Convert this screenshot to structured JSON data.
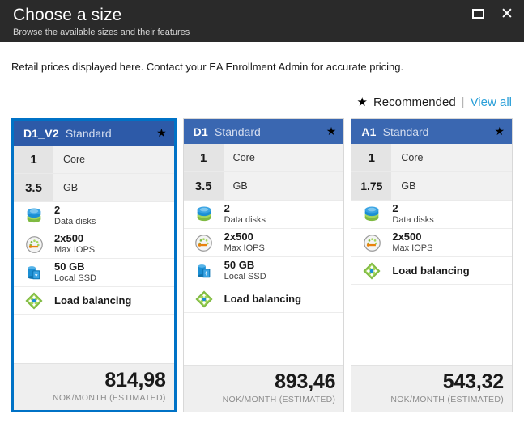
{
  "window": {
    "title": "Choose a size",
    "subtitle": "Browse the available sizes and their features",
    "maximize_icon": "maximize-icon",
    "close_icon": "close-icon"
  },
  "notice": "Retail prices displayed here. Contact your EA Enrollment Admin for accurate pricing.",
  "filters": {
    "star_glyph": "★",
    "recommended_label": "Recommended",
    "separator": "|",
    "view_all_label": "View all",
    "link_color": "#2a9fd8"
  },
  "cards": [
    {
      "name": "D1_V2",
      "tier": "Standard",
      "star_glyph": "★",
      "selected": true,
      "specs": [
        {
          "value": "1",
          "label": "Core"
        },
        {
          "value": "3.5",
          "label": "GB"
        }
      ],
      "features": [
        {
          "icon": "data-disks-icon",
          "value": "2",
          "caption": "Data disks"
        },
        {
          "icon": "max-iops-icon",
          "value": "2x500",
          "caption": "Max IOPS"
        },
        {
          "icon": "local-ssd-icon",
          "value": "50 GB",
          "caption": "Local SSD"
        },
        {
          "icon": "load-balancing-icon",
          "value": "Load balancing",
          "caption": ""
        }
      ],
      "price": "814,98",
      "price_unit": "NOK/MONTH (ESTIMATED)"
    },
    {
      "name": "D1",
      "tier": "Standard",
      "star_glyph": "★",
      "selected": false,
      "specs": [
        {
          "value": "1",
          "label": "Core"
        },
        {
          "value": "3.5",
          "label": "GB"
        }
      ],
      "features": [
        {
          "icon": "data-disks-icon",
          "value": "2",
          "caption": "Data disks"
        },
        {
          "icon": "max-iops-icon",
          "value": "2x500",
          "caption": "Max IOPS"
        },
        {
          "icon": "local-ssd-icon",
          "value": "50 GB",
          "caption": "Local SSD"
        },
        {
          "icon": "load-balancing-icon",
          "value": "Load balancing",
          "caption": ""
        }
      ],
      "price": "893,46",
      "price_unit": "NOK/MONTH (ESTIMATED)"
    },
    {
      "name": "A1",
      "tier": "Standard",
      "star_glyph": "★",
      "selected": false,
      "specs": [
        {
          "value": "1",
          "label": "Core"
        },
        {
          "value": "1.75",
          "label": "GB"
        }
      ],
      "features": [
        {
          "icon": "data-disks-icon",
          "value": "2",
          "caption": "Data disks"
        },
        {
          "icon": "max-iops-icon",
          "value": "2x500",
          "caption": "Max IOPS"
        },
        {
          "icon": "load-balancing-icon",
          "value": "Load balancing",
          "caption": ""
        }
      ],
      "price": "543,32",
      "price_unit": "NOK/MONTH (ESTIMATED)"
    }
  ],
  "colors": {
    "titlebar_bg": "#2a2a2a",
    "card_header_bg": "#3a67b1",
    "selected_border": "#0072c6",
    "link": "#2a9fd8"
  }
}
